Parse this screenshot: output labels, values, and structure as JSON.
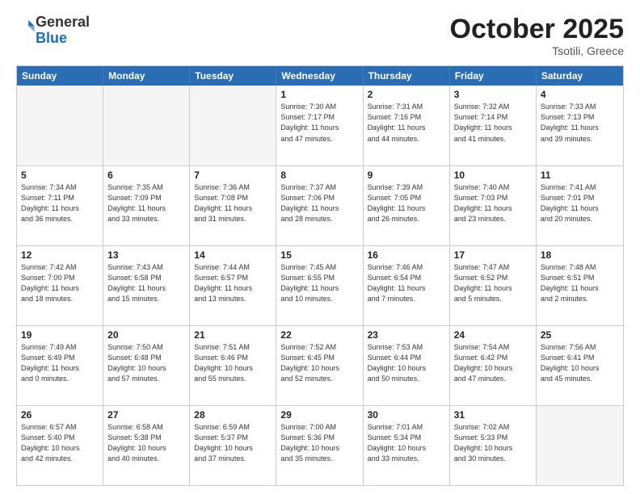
{
  "header": {
    "logo_general": "General",
    "logo_blue": "Blue",
    "month": "October 2025",
    "location": "Tsotili, Greece"
  },
  "days_of_week": [
    "Sunday",
    "Monday",
    "Tuesday",
    "Wednesday",
    "Thursday",
    "Friday",
    "Saturday"
  ],
  "rows": [
    [
      {
        "day": "",
        "empty": true,
        "lines": []
      },
      {
        "day": "",
        "empty": true,
        "lines": []
      },
      {
        "day": "",
        "empty": true,
        "lines": []
      },
      {
        "day": "1",
        "empty": false,
        "lines": [
          "Sunrise: 7:30 AM",
          "Sunset: 7:17 PM",
          "Daylight: 11 hours",
          "and 47 minutes."
        ]
      },
      {
        "day": "2",
        "empty": false,
        "lines": [
          "Sunrise: 7:31 AM",
          "Sunset: 7:16 PM",
          "Daylight: 11 hours",
          "and 44 minutes."
        ]
      },
      {
        "day": "3",
        "empty": false,
        "lines": [
          "Sunrise: 7:32 AM",
          "Sunset: 7:14 PM",
          "Daylight: 11 hours",
          "and 41 minutes."
        ]
      },
      {
        "day": "4",
        "empty": false,
        "lines": [
          "Sunrise: 7:33 AM",
          "Sunset: 7:13 PM",
          "Daylight: 11 hours",
          "and 39 minutes."
        ]
      }
    ],
    [
      {
        "day": "5",
        "empty": false,
        "lines": [
          "Sunrise: 7:34 AM",
          "Sunset: 7:11 PM",
          "Daylight: 11 hours",
          "and 36 minutes."
        ]
      },
      {
        "day": "6",
        "empty": false,
        "lines": [
          "Sunrise: 7:35 AM",
          "Sunset: 7:09 PM",
          "Daylight: 11 hours",
          "and 33 minutes."
        ]
      },
      {
        "day": "7",
        "empty": false,
        "lines": [
          "Sunrise: 7:36 AM",
          "Sunset: 7:08 PM",
          "Daylight: 11 hours",
          "and 31 minutes."
        ]
      },
      {
        "day": "8",
        "empty": false,
        "lines": [
          "Sunrise: 7:37 AM",
          "Sunset: 7:06 PM",
          "Daylight: 11 hours",
          "and 28 minutes."
        ]
      },
      {
        "day": "9",
        "empty": false,
        "lines": [
          "Sunrise: 7:39 AM",
          "Sunset: 7:05 PM",
          "Daylight: 11 hours",
          "and 26 minutes."
        ]
      },
      {
        "day": "10",
        "empty": false,
        "lines": [
          "Sunrise: 7:40 AM",
          "Sunset: 7:03 PM",
          "Daylight: 11 hours",
          "and 23 minutes."
        ]
      },
      {
        "day": "11",
        "empty": false,
        "lines": [
          "Sunrise: 7:41 AM",
          "Sunset: 7:01 PM",
          "Daylight: 11 hours",
          "and 20 minutes."
        ]
      }
    ],
    [
      {
        "day": "12",
        "empty": false,
        "lines": [
          "Sunrise: 7:42 AM",
          "Sunset: 7:00 PM",
          "Daylight: 11 hours",
          "and 18 minutes."
        ]
      },
      {
        "day": "13",
        "empty": false,
        "lines": [
          "Sunrise: 7:43 AM",
          "Sunset: 6:58 PM",
          "Daylight: 11 hours",
          "and 15 minutes."
        ]
      },
      {
        "day": "14",
        "empty": false,
        "lines": [
          "Sunrise: 7:44 AM",
          "Sunset: 6:57 PM",
          "Daylight: 11 hours",
          "and 13 minutes."
        ]
      },
      {
        "day": "15",
        "empty": false,
        "lines": [
          "Sunrise: 7:45 AM",
          "Sunset: 6:55 PM",
          "Daylight: 11 hours",
          "and 10 minutes."
        ]
      },
      {
        "day": "16",
        "empty": false,
        "lines": [
          "Sunrise: 7:46 AM",
          "Sunset: 6:54 PM",
          "Daylight: 11 hours",
          "and 7 minutes."
        ]
      },
      {
        "day": "17",
        "empty": false,
        "lines": [
          "Sunrise: 7:47 AM",
          "Sunset: 6:52 PM",
          "Daylight: 11 hours",
          "and 5 minutes."
        ]
      },
      {
        "day": "18",
        "empty": false,
        "lines": [
          "Sunrise: 7:48 AM",
          "Sunset: 6:51 PM",
          "Daylight: 11 hours",
          "and 2 minutes."
        ]
      }
    ],
    [
      {
        "day": "19",
        "empty": false,
        "lines": [
          "Sunrise: 7:49 AM",
          "Sunset: 6:49 PM",
          "Daylight: 11 hours",
          "and 0 minutes."
        ]
      },
      {
        "day": "20",
        "empty": false,
        "lines": [
          "Sunrise: 7:50 AM",
          "Sunset: 6:48 PM",
          "Daylight: 10 hours",
          "and 57 minutes."
        ]
      },
      {
        "day": "21",
        "empty": false,
        "lines": [
          "Sunrise: 7:51 AM",
          "Sunset: 6:46 PM",
          "Daylight: 10 hours",
          "and 55 minutes."
        ]
      },
      {
        "day": "22",
        "empty": false,
        "lines": [
          "Sunrise: 7:52 AM",
          "Sunset: 6:45 PM",
          "Daylight: 10 hours",
          "and 52 minutes."
        ]
      },
      {
        "day": "23",
        "empty": false,
        "lines": [
          "Sunrise: 7:53 AM",
          "Sunset: 6:44 PM",
          "Daylight: 10 hours",
          "and 50 minutes."
        ]
      },
      {
        "day": "24",
        "empty": false,
        "lines": [
          "Sunrise: 7:54 AM",
          "Sunset: 6:42 PM",
          "Daylight: 10 hours",
          "and 47 minutes."
        ]
      },
      {
        "day": "25",
        "empty": false,
        "lines": [
          "Sunrise: 7:56 AM",
          "Sunset: 6:41 PM",
          "Daylight: 10 hours",
          "and 45 minutes."
        ]
      }
    ],
    [
      {
        "day": "26",
        "empty": false,
        "lines": [
          "Sunrise: 6:57 AM",
          "Sunset: 5:40 PM",
          "Daylight: 10 hours",
          "and 42 minutes."
        ]
      },
      {
        "day": "27",
        "empty": false,
        "lines": [
          "Sunrise: 6:58 AM",
          "Sunset: 5:38 PM",
          "Daylight: 10 hours",
          "and 40 minutes."
        ]
      },
      {
        "day": "28",
        "empty": false,
        "lines": [
          "Sunrise: 6:59 AM",
          "Sunset: 5:37 PM",
          "Daylight: 10 hours",
          "and 37 minutes."
        ]
      },
      {
        "day": "29",
        "empty": false,
        "lines": [
          "Sunrise: 7:00 AM",
          "Sunset: 5:36 PM",
          "Daylight: 10 hours",
          "and 35 minutes."
        ]
      },
      {
        "day": "30",
        "empty": false,
        "lines": [
          "Sunrise: 7:01 AM",
          "Sunset: 5:34 PM",
          "Daylight: 10 hours",
          "and 33 minutes."
        ]
      },
      {
        "day": "31",
        "empty": false,
        "lines": [
          "Sunrise: 7:02 AM",
          "Sunset: 5:33 PM",
          "Daylight: 10 hours",
          "and 30 minutes."
        ]
      },
      {
        "day": "",
        "empty": true,
        "lines": []
      }
    ]
  ]
}
